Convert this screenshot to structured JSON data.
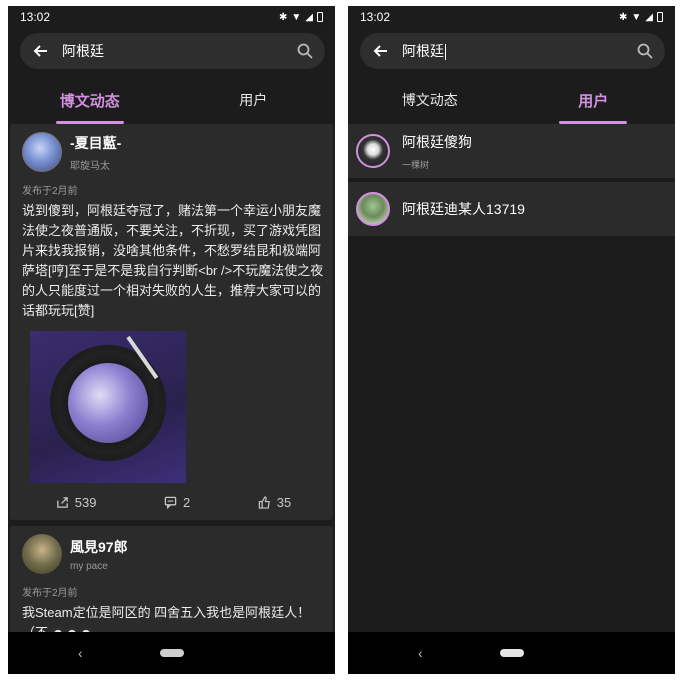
{
  "status": {
    "time": "13:02"
  },
  "left": {
    "search": {
      "query": "阿根廷"
    },
    "tabs": [
      {
        "label": "博文动态",
        "active": true
      },
      {
        "label": "用户",
        "active": false
      }
    ],
    "posts": [
      {
        "author": "-夏目藍-",
        "subtitle": "耶旋马太",
        "time": "发布于2月前",
        "body": "说到傻到，阿根廷夺冠了，赌法第一个幸运小朋友魔法使之夜普通版，不要关注，不折现，买了游戏凭图片来找我报销，没啥其他条件，不愁罗结昆和极端阿萨塔[哼]至于是不是我自行判断<br />不玩魔法使之夜的人只能度过一个相对失败的人生，推荐大家可以的话都玩玩[赞]",
        "shares": "539",
        "comments": "2",
        "likes": "35"
      },
      {
        "author": "風見97郎",
        "subtitle": "my pace",
        "time": "发布于2月前",
        "body": "我Steam定位是阿区的 四舍五入我也是阿根廷人！（不"
      }
    ]
  },
  "right": {
    "search": {
      "query": "阿根廷"
    },
    "tabs": [
      {
        "label": "博文动态",
        "active": false
      },
      {
        "label": "用户",
        "active": true
      }
    ],
    "users": [
      {
        "name": "阿根廷傻狗",
        "sub": "一棵树"
      },
      {
        "name": "阿根廷迪某人13719",
        "sub": ""
      }
    ]
  },
  "nav": {
    "back_glyph": "‹"
  }
}
